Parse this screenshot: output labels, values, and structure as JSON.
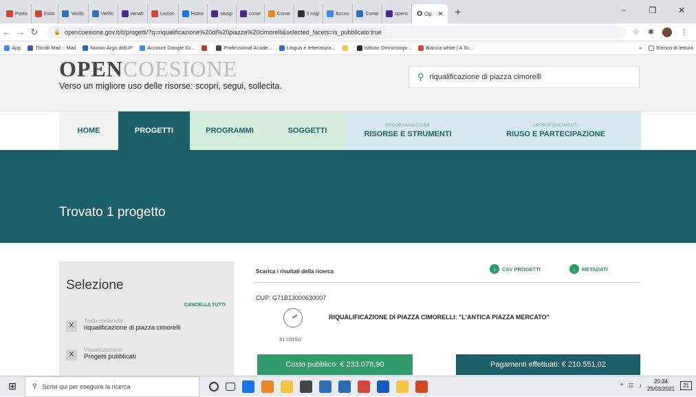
{
  "browser": {
    "tabs": [
      {
        "label": "Posta",
        "color": "#d44638"
      },
      {
        "label": "Esito",
        "color": "#d44638"
      },
      {
        "label": "Verific",
        "color": "#2f6fb5"
      },
      {
        "label": "Verific",
        "color": "#2f6fb5"
      },
      {
        "label": "venafr",
        "color": "#4a2a8a"
      },
      {
        "label": "Lezion",
        "color": "#d44638"
      },
      {
        "label": "Home",
        "color": "#1a73e8"
      },
      {
        "label": "sissgi",
        "color": "#4a2a8a"
      },
      {
        "label": "come",
        "color": "#4a2a8a"
      },
      {
        "label": "Come",
        "color": "#e8862a"
      },
      {
        "label": "Il migl",
        "color": "#333333"
      },
      {
        "label": "Accou",
        "color": "#4285f4"
      },
      {
        "label": "Come",
        "color": "#2f6fb5"
      },
      {
        "label": "openc",
        "color": "#4a2a8a"
      }
    ],
    "active_tab": {
      "label": "Op",
      "icon": "O"
    },
    "new_tab": "+",
    "window_controls": [
      "−",
      "❐",
      "✕"
    ],
    "url": "opencoesione.gov.it/it/progetti/?q=riqualificazione%20di%20piazza%20cimorelli&selected_facets=is_pubblicato:true",
    "bookmarks": [
      {
        "label": "App",
        "color": "#4285f4"
      },
      {
        "label": "Tiscali Mail :: Mail",
        "color": "#3a5ba8"
      },
      {
        "label": "Nuovo Argo didUP",
        "color": "#2a6ab0"
      },
      {
        "label": "Account Google Gi...",
        "color": "#4285f4"
      },
      {
        "label": "",
        "color": "#c0392b"
      },
      {
        "label": "Professional Acade...",
        "color": "#444444"
      },
      {
        "label": "Lingua e letteratura...",
        "color": "#2f6fb5"
      },
      {
        "label": "",
        "color": "#f4c542"
      },
      {
        "label": "Istituto Omnicompr...",
        "color": "#2a2a2a"
      },
      {
        "label": "Bianca white | A Sc...",
        "color": "#d44638"
      }
    ],
    "bookmarks_more": "»",
    "reading_list": "Elenco di lettura"
  },
  "site": {
    "logo_bold": "OPEN",
    "logo_light": "COESIONE",
    "tagline": "Verso un migliore uso delle risorse: scopri, segui, sollecita.",
    "search_value": "riqualificazione di piazza cimorelli",
    "menu": [
      {
        "label": "HOME",
        "sub": "",
        "bg": "#f2f2f2",
        "color": "#1e6268",
        "width": 86
      },
      {
        "label": "PROGETTI",
        "sub": "",
        "bg": "#1b6069",
        "color": "#ffffff",
        "width": 104
      },
      {
        "label": "PROGRAMMI",
        "sub": "",
        "bg": "#d4eddc",
        "color": "#1e6268",
        "width": 116
      },
      {
        "label": "SOGGETTI",
        "sub": "",
        "bg": "#d4eddc",
        "color": "#1e6268",
        "width": 110
      },
      {
        "label": "RISORSE E STRUMENTI",
        "sub": "PROGRAMMAZIONE",
        "bg": "#d5e8ef",
        "color": "#1e6268",
        "width": 182
      },
      {
        "label": "RIUSO E PARTECIPAZIONE",
        "sub": "APPROFONDIMENTI",
        "bg": "#d5e8ef",
        "color": "#1e6268",
        "width": 216
      }
    ],
    "results_title": "Trovato 1 progetto",
    "selection": {
      "title": "Selezione",
      "cancel_all": "CANCELLA TUTTI",
      "filters": [
        {
          "label": "Testo contenuto:",
          "value": "riqualificazione di piazza cimorelli"
        },
        {
          "label": "Visualizzazione:",
          "value": "Progetti pubblicati"
        }
      ],
      "remove_symbol": "X"
    },
    "results": {
      "download_label": "Scarica i risultati della ricerca",
      "csv": "CSV PROGETTI",
      "metadata": "METADATI",
      "cup": "CUP: G71B13000630007",
      "status": "In corso",
      "project_title": "RIQUALIFICAZIONE DI PIAZZA CIMORELLI: \"L'ANTICA PIAZZA MERCATO\"",
      "public_cost": "Costo pubblico: € 233.078,90",
      "payments": "Pagamenti effettuati: € 210.551,02"
    }
  },
  "taskbar": {
    "search_placeholder": "Scrivi qui per eseguire la ricerca",
    "apps": [
      "#1a73e8",
      "#e8862a",
      "#f4c542",
      "#444444",
      "#2f6fb5",
      "#2a6ab0",
      "#d44638",
      "#185abd",
      "#f4c542",
      "#d24726"
    ],
    "time": "20:34",
    "date": "25/03/2021",
    "notifications": "21"
  }
}
